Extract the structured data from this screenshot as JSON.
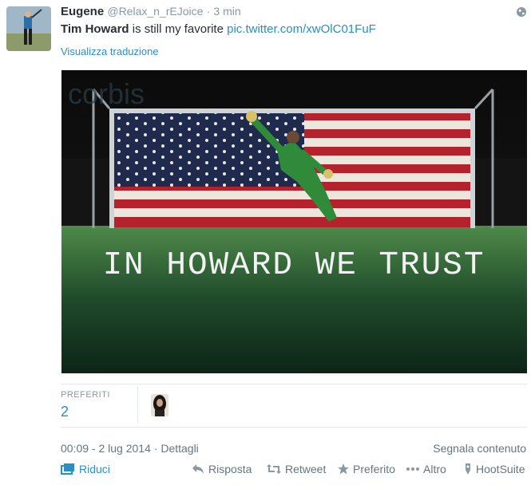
{
  "tweet": {
    "fullname": "Eugene",
    "username": "@Relax_n_rEJoice",
    "separator": "·",
    "time": "3 min",
    "text_bold": "Tim Howard",
    "text_rest": " is still my favorite ",
    "link": "pic.twitter.com/xwOlC01FuF",
    "translate": "Visualizza traduzione"
  },
  "media": {
    "watermark": "corbis",
    "caption": "IN HOWARD WE TRUST"
  },
  "stats": {
    "favorites_label": "PREFERITI",
    "favorites_count": "2"
  },
  "details": {
    "timestamp": "00:09 - 2 lug 2014",
    "dot": "·",
    "details_link": "Dettagli",
    "report": "Segnala contenuto"
  },
  "actions": {
    "collapse": "Riduci",
    "reply": "Risposta",
    "retweet": "Retweet",
    "favorite": "Preferito",
    "more": "Altro",
    "hootsuite": "HootSuite"
  },
  "colors": {
    "link": "#2a8fc4",
    "muted": "#8899a6",
    "text": "#292f33"
  }
}
